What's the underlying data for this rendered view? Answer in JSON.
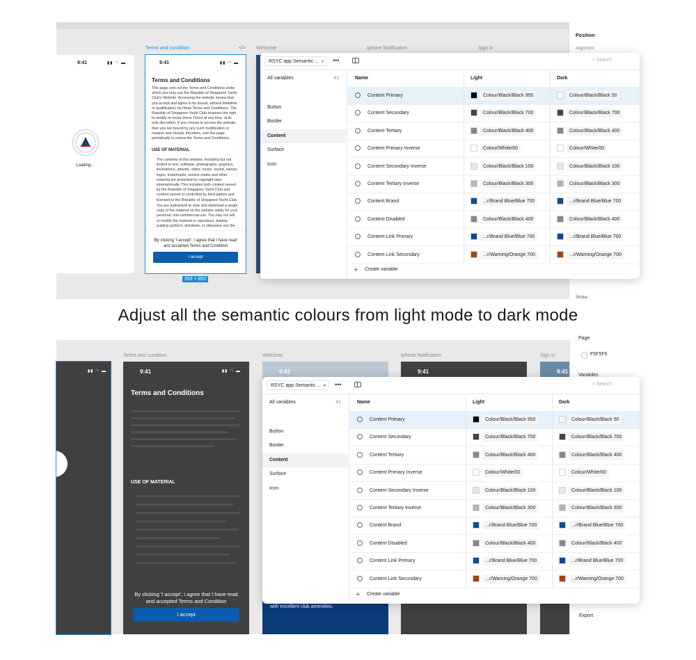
{
  "caption": "Adjust all the semantic colours from light mode to dark mode",
  "top": {
    "frame_labels": {
      "terms": "Terms and condition",
      "code_icon": "</>",
      "welcome": "Welcome",
      "notification": "Iphone Notification",
      "signin": "Sign in"
    },
    "loading_phone": {
      "time": "9:41",
      "loading": "Loading.."
    },
    "terms_phone": {
      "time": "9:41",
      "title": "Terms and Conditions",
      "intro": "This page sets out the Terms and Conditions under which you may use the Republic of Singapore Yacht Club's Website. Accessing the website means that you accept and agree to be bound, without limitation or qualification, by these Terms and Conditions. The Republic of Singapore Yacht Club reserves the right to modify or revise these Terms at any time, at its sole discretion. If you choose to access the website, then you are bound by any such modification or revision and should, therefore, visit this page periodically to review the Terms and Conditions.",
      "section": "USE OF MATERIAL",
      "bullet1": "The contents of this website, including but not limited to text, software, photographs, graphics, illustrations, artwork, video, music, sound, names, logos, trademarks, service marks and other material are protected by copyright laws internationally. This includes both content owned by the Republic of Singapore Yacht Club and content owned or controlled by third parties and licensed to the Republic of Singapore Yacht Club.",
      "bullet2": "You are authorised to view and download a single copy of the material on the website solely for your personal, non-commercial use. You may not sell or modify the material or reproduce, display, publicly perform, distribute, or otherwise use the material",
      "agree": "By clicking 'I accept', I agree that I have read and accepted Terms and Condition",
      "accept": "I accept",
      "size_badge": "393 × 852"
    },
    "right_panel": {
      "position": "Position",
      "alignment": "Alignment",
      "stroke": "Stroke"
    }
  },
  "bottom": {
    "frame_labels": {
      "terms": "Terms and condition",
      "welcome": "Welcome",
      "notification": "Iphone Notification",
      "signin": "Sign in"
    },
    "terms_phone": {
      "time": "9:41",
      "title": "Terms and Conditions",
      "section": "USE OF MATERIAL",
      "agree": "By clicking 'I accept', I agree that I have read and accepted Terms and Condition",
      "accept": "I accept"
    },
    "welcome_phone": {
      "time": "9:41",
      "text": "with excellent club amenities."
    },
    "notification_phone": {
      "time": "9:41"
    },
    "signin_phone": {
      "time": "9:41"
    },
    "right_panel": {
      "page": "Page",
      "page_color": "F5F5F5",
      "variables": "Variables",
      "export": "Export"
    }
  },
  "variables_panel": {
    "collection": "RSYC app Semantic ...",
    "search_placeholder": "Search",
    "groups": [
      {
        "label": "All variables",
        "count": "41"
      },
      {
        "label": "Button"
      },
      {
        "label": "Border"
      },
      {
        "label": "Content"
      },
      {
        "label": "Surface"
      },
      {
        "label": "Icon"
      }
    ],
    "columns": {
      "name": "Name",
      "light": "Light",
      "dark": "Dark"
    },
    "rows": [
      {
        "name": "Content Primary",
        "light": "Colour/Black/Black 950",
        "dark": "Colour/Black/Black 50",
        "light_color": "#000000",
        "dark_color": "#f7f7f7"
      },
      {
        "name": "Content Secondary",
        "light": "Colour/Black/Black 700",
        "dark": "Colour/Black/Black 700",
        "light_color": "#444444",
        "dark_color": "#444444"
      },
      {
        "name": "Content Tertiary",
        "light": "Colour/Black/Black 400",
        "dark": "Colour/Black/Black 400",
        "light_color": "#888888",
        "dark_color": "#888888"
      },
      {
        "name": "Content Primary Inverse",
        "light": "Colour/White/00",
        "dark": "Colour/White/00",
        "light_color": "#ffffff",
        "dark_color": "#ffffff"
      },
      {
        "name": "Content Secondary Inverse",
        "light": "Colour/Black/Black 100",
        "dark": "Colour/Black/Black 100",
        "light_color": "#e6e6e6",
        "dark_color": "#e6e6e6"
      },
      {
        "name": "Content Tertiary Inverse",
        "light": "Colour/Black/Black 300",
        "dark": "Colour/Black/Black 300",
        "light_color": "#b5b5b5",
        "dark_color": "#b5b5b5"
      },
      {
        "name": "Content Brand",
        "light": "...r/Brand Blue/Blue 700",
        "dark": "...r/Brand Blue/Blue 700",
        "light_color": "#0b4a96",
        "dark_color": "#0b4a96"
      },
      {
        "name": "Content Disabled",
        "light": "Colour/Black/Black 400",
        "dark": "Colour/Black/Black 400",
        "light_color": "#888888",
        "dark_color": "#888888"
      },
      {
        "name": "Content Link Primary",
        "light": "...r/Brand Blue/Blue 700",
        "dark": "...r/Brand Blue/Blue 700",
        "light_color": "#0b4a96",
        "dark_color": "#0b4a96"
      },
      {
        "name": "Content Link Secondary",
        "light": "...r/Warning/Orange 700",
        "dark": "...r/Warning/Orange 700",
        "light_color": "#a8420f",
        "dark_color": "#a8420f"
      }
    ],
    "create_label": "Create variable"
  },
  "colors": {
    "selection_blue": "#1e8ad6",
    "accept_blue": "#0b5cad",
    "dark_frame": "#404040",
    "canvas": "#e9e9e9"
  }
}
